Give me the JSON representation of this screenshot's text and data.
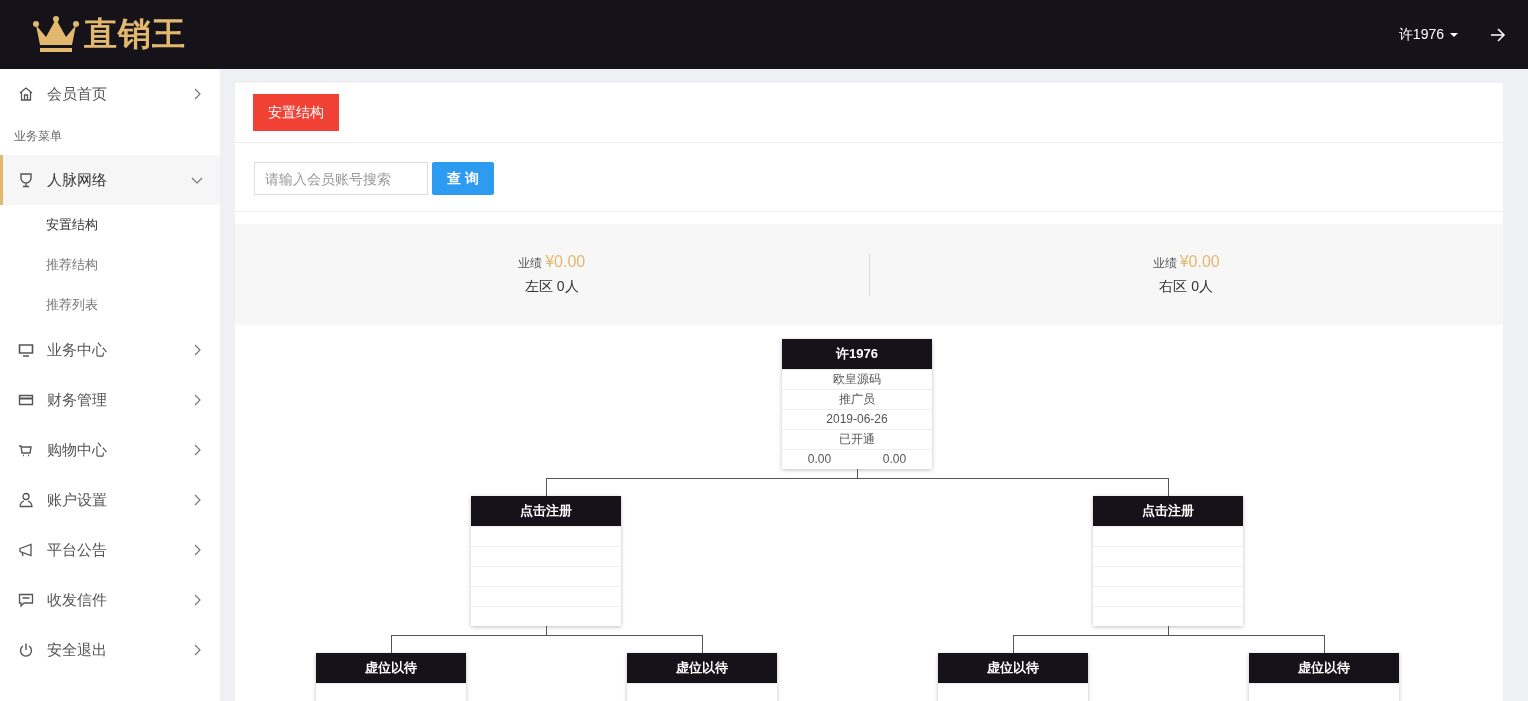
{
  "header": {
    "logo": "直销王",
    "user": "许1976"
  },
  "sidebar": {
    "items": [
      {
        "kind": "link",
        "label": "会员首页",
        "expanded": false
      },
      {
        "kind": "section",
        "label": "业务菜单"
      },
      {
        "kind": "link",
        "label": "人脉网络",
        "expanded": true,
        "children": [
          {
            "label": "安置结构",
            "selected": true
          },
          {
            "label": "推荐结构",
            "selected": false
          },
          {
            "label": "推荐列表",
            "selected": false
          }
        ]
      },
      {
        "kind": "link",
        "label": "业务中心",
        "expanded": false
      },
      {
        "kind": "link",
        "label": "财务管理",
        "expanded": false
      },
      {
        "kind": "link",
        "label": "购物中心",
        "expanded": false
      },
      {
        "kind": "link",
        "label": "账户设置",
        "expanded": false
      },
      {
        "kind": "link",
        "label": "平台公告",
        "expanded": false
      },
      {
        "kind": "link",
        "label": "收发信件",
        "expanded": false
      },
      {
        "kind": "link",
        "label": "安全退出",
        "expanded": false
      }
    ]
  },
  "tabs": [
    {
      "label": "安置结构",
      "selected": true
    }
  ],
  "search": {
    "placeholder": "请输入会员账号搜索",
    "button": "查 询"
  },
  "stats": [
    {
      "label": "业绩",
      "amount": "¥0.00",
      "zone": "左区 0人"
    },
    {
      "label": "业绩",
      "amount": "¥0.00",
      "zone": "右区 0人"
    }
  ],
  "tree": {
    "title": "许1976",
    "lines": [
      "欧皇源码",
      "推广员",
      "2019-06-26",
      "已开通"
    ],
    "amounts": [
      "0.00",
      "0.00"
    ],
    "children": [
      {
        "title": "点击注册",
        "children": [
          {
            "title": "虚位以待"
          },
          {
            "title": "虚位以待"
          }
        ]
      },
      {
        "title": "点击注册",
        "children": [
          {
            "title": "虚位以待"
          },
          {
            "title": "虚位以待"
          }
        ]
      }
    ]
  }
}
